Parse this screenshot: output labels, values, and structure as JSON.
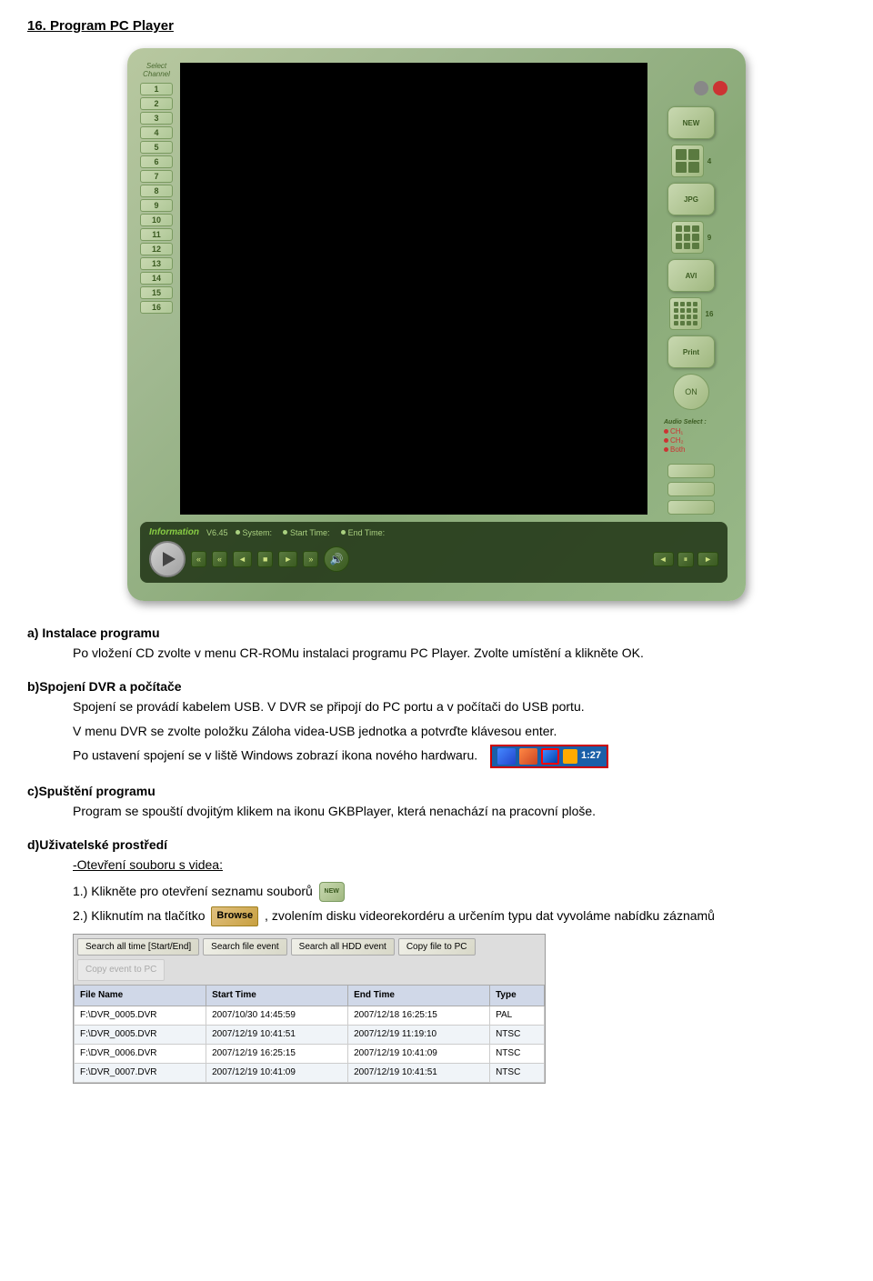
{
  "page": {
    "title": "16. Program PC Player"
  },
  "player": {
    "channels": [
      "1",
      "2",
      "3",
      "4",
      "5",
      "6",
      "7",
      "8",
      "9",
      "10",
      "11",
      "12",
      "13",
      "14",
      "15",
      "16"
    ],
    "channel_select_label": "Select Channel",
    "version": "V6.45",
    "info_brand": "Information",
    "system_label": "System:",
    "start_time_label": "Start Time:",
    "end_time_label": "End Time:",
    "buttons": {
      "new": "NEW",
      "jpg": "JPG",
      "avi": "AVI",
      "print": "Print",
      "on": "ON"
    },
    "audio": {
      "title": "Audio Select :",
      "options": [
        "CH₁",
        "CH₂",
        "Both"
      ]
    },
    "controls": {
      "rew_fast": "«",
      "rew": "‹",
      "prev": "◄",
      "stop": "■",
      "fwd": "›",
      "fwd_fast": "»",
      "prev2": "◄",
      "pause": "⏸",
      "next2": "►"
    },
    "grid_nums": [
      "4",
      "9",
      "16"
    ]
  },
  "sections": {
    "a": {
      "heading": "a) Instalace programu",
      "text1": "Po vložení CD zvolte v menu CR-ROMu instalaci programu PC Player. Zvolte umístění a klikněte OK."
    },
    "b": {
      "heading": "b)",
      "heading_bold": "Spojení DVR a počítače",
      "text1": "Spojení se provádí kabelem USB. V DVR se připojí do PC portu a v počítači do USB portu.",
      "text2": "V menu DVR se zvolte položku Záloha videa-USB jednotka a potvrďte klávesou enter.",
      "text3": "Po ustavení spojení se v liště Windows zobrazí ikona nového hardwaru."
    },
    "c": {
      "heading": "c)",
      "heading_bold": "Spuštění programu",
      "text1": "Program se spouští dvojitým klikem na ikonu GKBPlayer, která nenachází na pracovní ploše."
    },
    "d": {
      "heading": "d)",
      "heading_bold": "Uživatelské prostředí",
      "subheading": "-Otevření souboru s videa:",
      "item1": "1.) Klikněte pro otevření seznamu souborů",
      "item2_pre": "2.) Kliknutím na tlačítko",
      "item2_browse": "Browse",
      "item2_post": ", zvolením disku videorekordéru a určením typu dat vyvoláme nabídku záznamů"
    }
  },
  "taskbar": {
    "time": "1:27"
  },
  "file_browser": {
    "buttons": [
      "Search all time [Start/End]",
      "Search file event",
      "Search all HDD event",
      "Copy file to PC",
      "Copy event to PC"
    ],
    "columns": [
      "File Name",
      "Start Time",
      "End Time",
      "Type"
    ],
    "rows": [
      {
        "file": "F:\\DVR_0005.DVR",
        "start": "2007/10/30 14:45:59",
        "end": "2007/12/18 16:25:15",
        "type": "PAL"
      },
      {
        "file": "F:\\DVR_0005.DVR",
        "start": "2007/12/19 10:41:51",
        "end": "2007/12/19 11:19:10",
        "type": "NTSC"
      },
      {
        "file": "F:\\DVR_0006.DVR",
        "start": "2007/12/19 16:25:15",
        "end": "2007/12/19 10:41:09",
        "type": "NTSC"
      },
      {
        "file": "F:\\DVR_0007.DVR",
        "start": "2007/12/19 10:41:09",
        "end": "2007/12/19 10:41:51",
        "type": "NTSC"
      }
    ]
  }
}
